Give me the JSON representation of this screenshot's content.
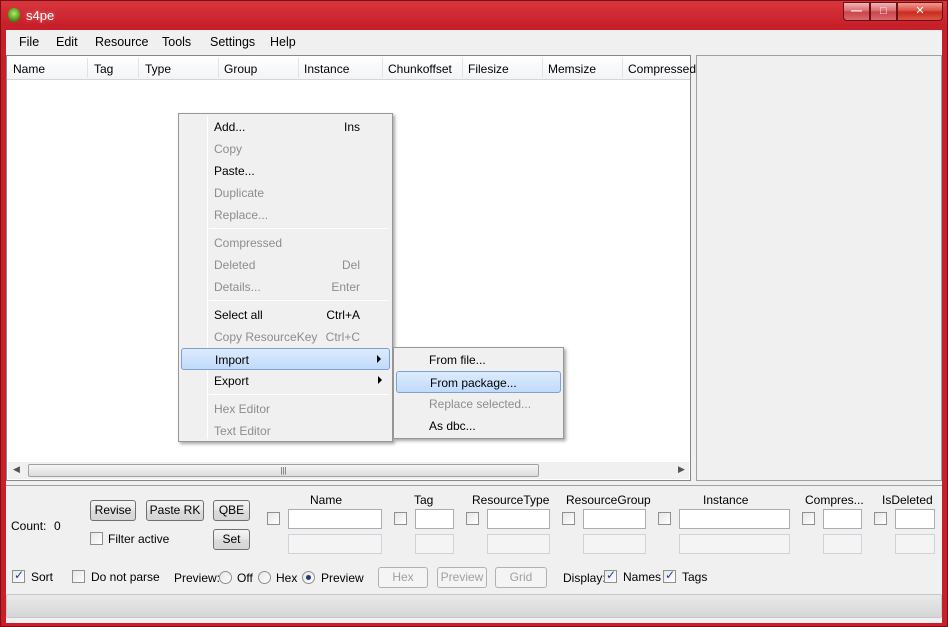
{
  "window": {
    "title": "s4pe"
  },
  "menubar": [
    "File",
    "Edit",
    "Resource",
    "Tools",
    "Settings",
    "Help"
  ],
  "list": {
    "columns": [
      "Name",
      "Tag",
      "Type",
      "Group",
      "Instance",
      "Chunkoffset",
      "Filesize",
      "Memsize",
      "Compressed"
    ],
    "scroll_grip": "|||"
  },
  "context_menu": {
    "items": [
      {
        "label": "Add...",
        "shortcut": "Ins"
      },
      {
        "label": "Copy",
        "shortcut": ""
      },
      {
        "label": "Paste...",
        "shortcut": ""
      },
      {
        "label": "Duplicate",
        "shortcut": ""
      },
      {
        "label": "Replace...",
        "shortcut": ""
      },
      {
        "label": "Compressed",
        "shortcut": ""
      },
      {
        "label": "Deleted",
        "shortcut": "Del"
      },
      {
        "label": "Details...",
        "shortcut": "Enter"
      },
      {
        "label": "Select all",
        "shortcut": "Ctrl+A"
      },
      {
        "label": "Copy ResourceKey",
        "shortcut": "Ctrl+C"
      },
      {
        "label": "Import",
        "shortcut": ""
      },
      {
        "label": "Export",
        "shortcut": ""
      },
      {
        "label": "Hex Editor",
        "shortcut": ""
      },
      {
        "label": "Text Editor",
        "shortcut": ""
      }
    ]
  },
  "import_submenu": {
    "items": [
      "From file...",
      "From package...",
      "Replace selected...",
      "As dbc..."
    ]
  },
  "bottom": {
    "count_label": "Count:",
    "count_value": "0",
    "revise": "Revise",
    "paste_rk": "Paste RK",
    "qbe": "QBE",
    "set": "Set",
    "filter_active": "Filter active",
    "filter_columns": [
      "Name",
      "Tag",
      "ResourceType",
      "ResourceGroup",
      "Instance",
      "Compres...",
      "IsDeleted"
    ],
    "sort": "Sort",
    "do_not_parse": "Do not parse",
    "preview_label": "Preview:",
    "preview_off": "Off",
    "preview_hex": "Hex",
    "preview_preview": "Preview",
    "btn_hex": "Hex",
    "btn_preview": "Preview",
    "btn_grid": "Grid",
    "display_label": "Display:",
    "display_names": "Names",
    "display_tags": "Tags"
  }
}
